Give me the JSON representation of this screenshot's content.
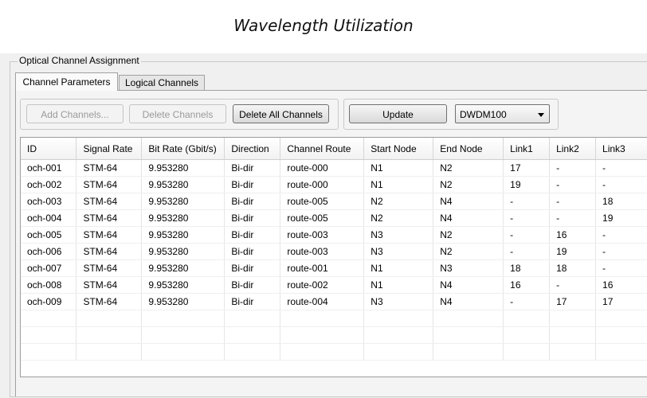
{
  "heading": "Wavelength Utilization",
  "group_title": "Optical Channel Assignment",
  "tabs": [
    {
      "label": "Channel Parameters",
      "active": true
    },
    {
      "label": "Logical Channels",
      "active": false
    }
  ],
  "toolbar": {
    "add_label": "Add Channels...",
    "delete_label": "Delete Channels",
    "delete_all_label": "Delete All Channels",
    "update_label": "Update",
    "grid_select": "DWDM100"
  },
  "table": {
    "columns": [
      "ID",
      "Signal Rate",
      "Bit Rate (Gbit/s)",
      "Direction",
      "Channel Route",
      "Start Node",
      "End Node",
      "Link1",
      "Link2",
      "Link3"
    ],
    "rows": [
      [
        "och-001",
        "STM-64",
        "9.953280",
        "Bi-dir",
        "route-000",
        "N1",
        "N2",
        "17",
        "-",
        "-"
      ],
      [
        "och-002",
        "STM-64",
        "9.953280",
        "Bi-dir",
        "route-000",
        "N1",
        "N2",
        "19",
        "-",
        "-"
      ],
      [
        "och-003",
        "STM-64",
        "9.953280",
        "Bi-dir",
        "route-005",
        "N2",
        "N4",
        "-",
        "-",
        "18"
      ],
      [
        "och-004",
        "STM-64",
        "9.953280",
        "Bi-dir",
        "route-005",
        "N2",
        "N4",
        "-",
        "-",
        "19"
      ],
      [
        "och-005",
        "STM-64",
        "9.953280",
        "Bi-dir",
        "route-003",
        "N3",
        "N2",
        "-",
        "16",
        "-"
      ],
      [
        "och-006",
        "STM-64",
        "9.953280",
        "Bi-dir",
        "route-003",
        "N3",
        "N2",
        "-",
        "19",
        "-"
      ],
      [
        "och-007",
        "STM-64",
        "9.953280",
        "Bi-dir",
        "route-001",
        "N1",
        "N3",
        "18",
        "18",
        "-"
      ],
      [
        "och-008",
        "STM-64",
        "9.953280",
        "Bi-dir",
        "route-002",
        "N1",
        "N4",
        "16",
        "-",
        "16"
      ],
      [
        "och-009",
        "STM-64",
        "9.953280",
        "Bi-dir",
        "route-004",
        "N3",
        "N4",
        "-",
        "17",
        "17"
      ]
    ]
  }
}
